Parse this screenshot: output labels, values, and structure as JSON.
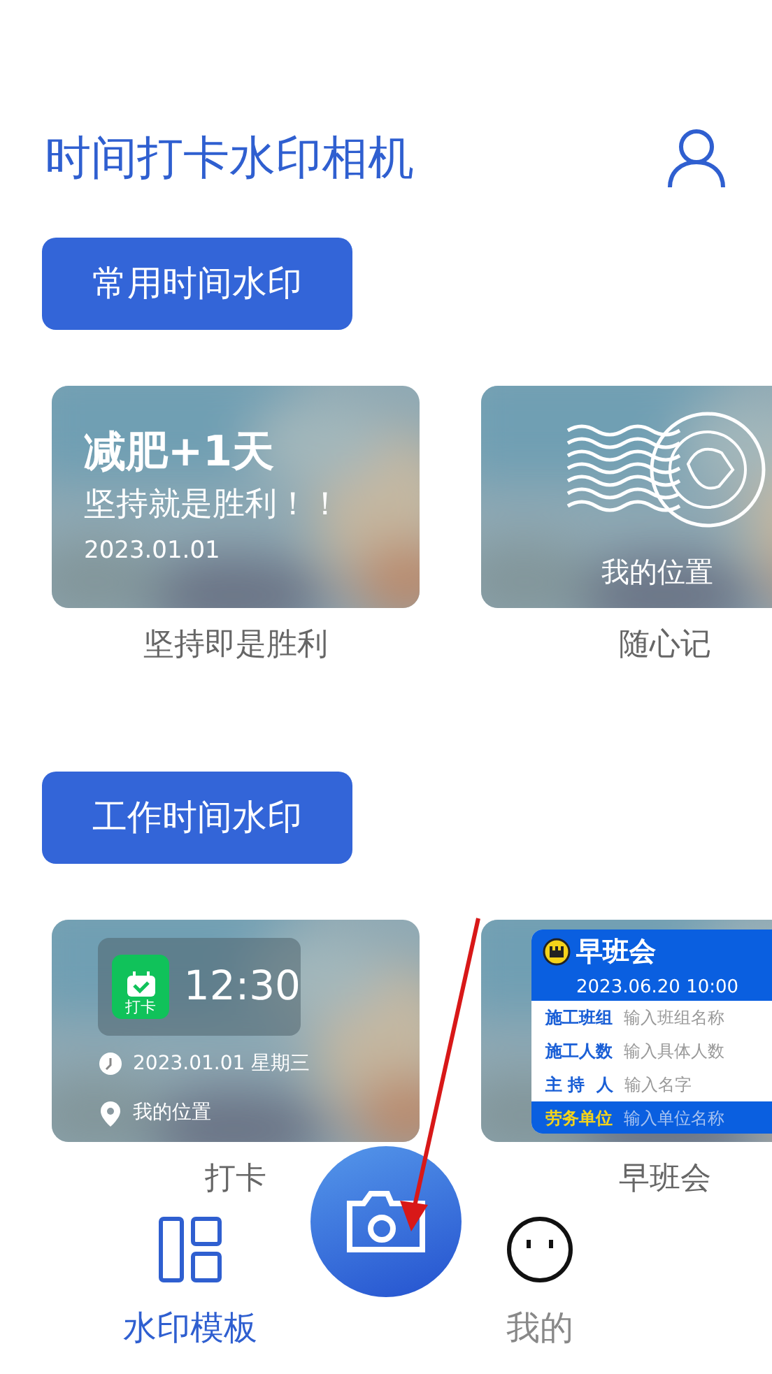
{
  "header": {
    "title": "时间打卡水印相机"
  },
  "sections": [
    {
      "title": "常用时间水印",
      "templates": [
        {
          "kind": "fitness",
          "name": "坚持即是胜利",
          "headline": "减肥+1天",
          "slogan": "坚持就是胜利！！",
          "date": "2023.01.01"
        },
        {
          "kind": "postmark",
          "name": "随心记",
          "location": "我的位置"
        }
      ]
    },
    {
      "title": "工作时间水印",
      "templates": [
        {
          "kind": "clock",
          "name": "打卡",
          "badge": "打卡",
          "time": "12:30",
          "date": "2023.01.01 星期三",
          "location": "我的位置"
        },
        {
          "kind": "meeting",
          "name": "早班会",
          "heading": "早班会",
          "datetime": "2023.06.20 10:00",
          "fields": [
            {
              "label": "施工班组",
              "value": "输入班组名称",
              "highlighted": false
            },
            {
              "label": "施工人数",
              "value": "输入具体人数",
              "highlighted": false
            },
            {
              "label": "主 持  人",
              "value": "输入名字",
              "highlighted": false
            },
            {
              "label": "劳务单位",
              "value": "输入单位名称",
              "highlighted": true
            }
          ]
        }
      ]
    }
  ],
  "bottom_nav": [
    {
      "kind": "templates",
      "label": "水印模板",
      "selected": true
    },
    {
      "kind": "profile",
      "label": "我的",
      "selected": false
    }
  ]
}
